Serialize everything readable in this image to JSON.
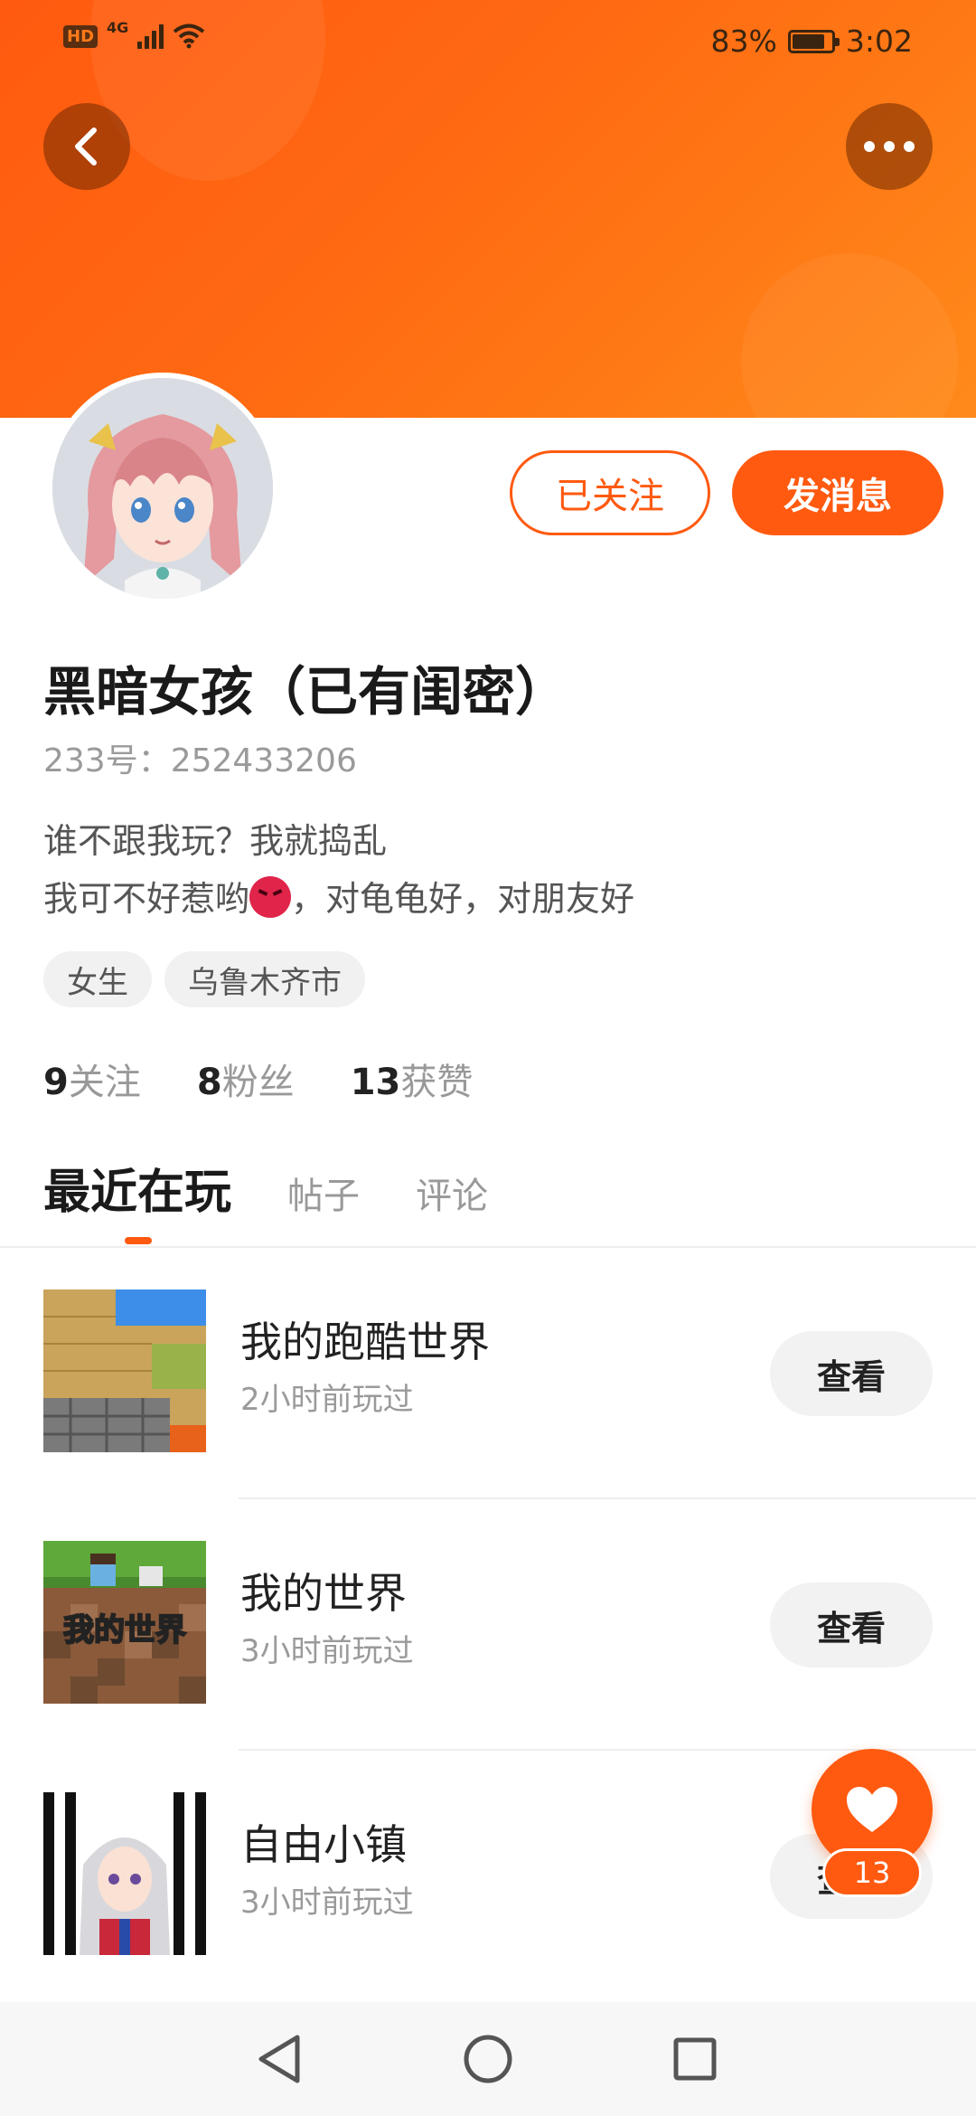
{
  "status_bar": {
    "network": "4G",
    "hd": "HD",
    "battery_text": "83%",
    "battery_level": 0.83,
    "time": "3:02"
  },
  "header": {
    "back_icon": "chevron-left-icon",
    "more_icon": "more-dots-icon"
  },
  "profile": {
    "follow_label": "已关注",
    "message_label": "发消息",
    "nickname": "黑暗女孩（已有闺密）",
    "uid": "233号：252433206",
    "bio_line1": "谁不跟我玩？我就捣乱",
    "bio_line2_a": "我可不好惹哟",
    "bio_line2_b": "，对龟龟好，对朋友好",
    "tags": [
      "女生",
      "乌鲁木齐市"
    ]
  },
  "stats": [
    {
      "num": "9",
      "label": "关注"
    },
    {
      "num": "8",
      "label": "粉丝"
    },
    {
      "num": "13",
      "label": "获赞"
    }
  ],
  "tabs": [
    "最近在玩",
    "帖子",
    "评论"
  ],
  "games": [
    {
      "name": "我的跑酷世界",
      "time": "2小时前玩过",
      "button": "查看"
    },
    {
      "name": "我的世界",
      "time": "3小时前玩过",
      "button": "查看"
    },
    {
      "name": "自由小镇",
      "time": "3小时前玩过",
      "button": "查看"
    }
  ],
  "thumb_text": {
    "minecraft": "我的世界"
  },
  "like": {
    "count": "13"
  },
  "colors": {
    "accent": "#ff5a10"
  }
}
